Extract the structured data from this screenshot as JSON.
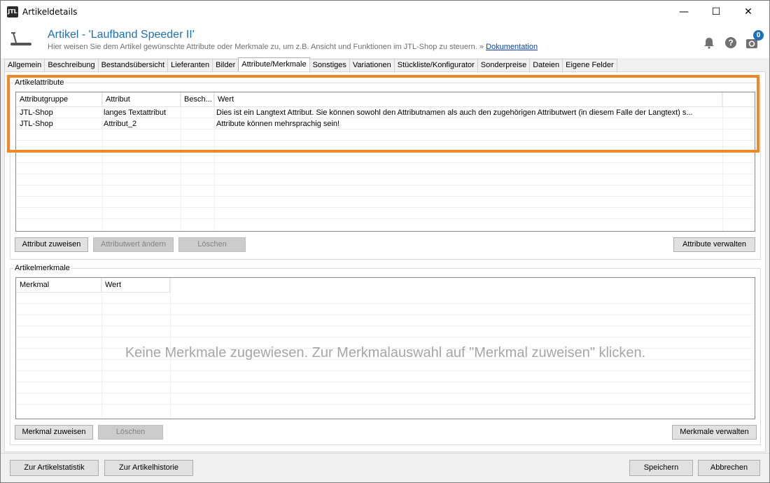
{
  "window": {
    "title": "Artikeldetails",
    "app_icon": "JTL",
    "controls": {
      "minimize": "—",
      "maximize": "☐",
      "close": "✕"
    }
  },
  "header": {
    "title": "Artikel - 'Laufband Speeder II'",
    "subtitle": "Hier weisen Sie dem Artikel gewünschte Attribute oder Merkmale zu, um z.B. Ansicht und Funktionen im JTL-Shop zu steuern. »",
    "doc_link": "Dokumentation",
    "badge_count": "0",
    "icons": [
      "treadmill-icon",
      "bell-icon",
      "help-icon",
      "sync-icon"
    ]
  },
  "tabs": [
    "Allgemein",
    "Beschreibung",
    "Bestandsübersicht",
    "Lieferanten",
    "Bilder",
    "Attribute/Merkmale",
    "Sonstiges",
    "Variationen",
    "Stückliste/Konfigurator",
    "Sonderpreise",
    "Dateien",
    "Eigene Felder"
  ],
  "active_tab": "Attribute/Merkmale",
  "attributes": {
    "group_label": "Artikelattribute",
    "columns": [
      "Attributgruppe",
      "Attribut",
      "Besch...",
      "Wert"
    ],
    "rows": [
      [
        "JTL-Shop",
        "langes Textattribut",
        "",
        "Dies ist ein Langtext Attribut. Sie können sowohl den Attributnamen als auch den zugehörigen Attributwert (in diesem Falle der Langtext) s..."
      ],
      [
        "JTL-Shop",
        "Attribut_2",
        "",
        "Attribute können mehrsprachig sein!"
      ]
    ],
    "buttons": {
      "assign": "Attribut zuweisen",
      "change_value": "Attributwert ändern",
      "delete": "Löschen",
      "manage": "Attribute verwalten"
    }
  },
  "features": {
    "group_label": "Artikelmerkmale",
    "columns": [
      "Merkmal",
      "Wert"
    ],
    "empty_message": "Keine Merkmale zugewiesen. Zur Merkmalauswahl auf \"Merkmal zuweisen\" klicken.",
    "buttons": {
      "assign": "Merkmal zuweisen",
      "delete": "Löschen",
      "manage": "Merkmale verwalten"
    }
  },
  "footer": {
    "statistics": "Zur Artikelstatistik",
    "history": "Zur Artikelhistorie",
    "save": "Speichern",
    "cancel": "Abbrechen"
  },
  "colors": {
    "title_blue": "#1e6fb8",
    "highlight_orange": "#f0882a",
    "disabled_text": "#838383"
  }
}
